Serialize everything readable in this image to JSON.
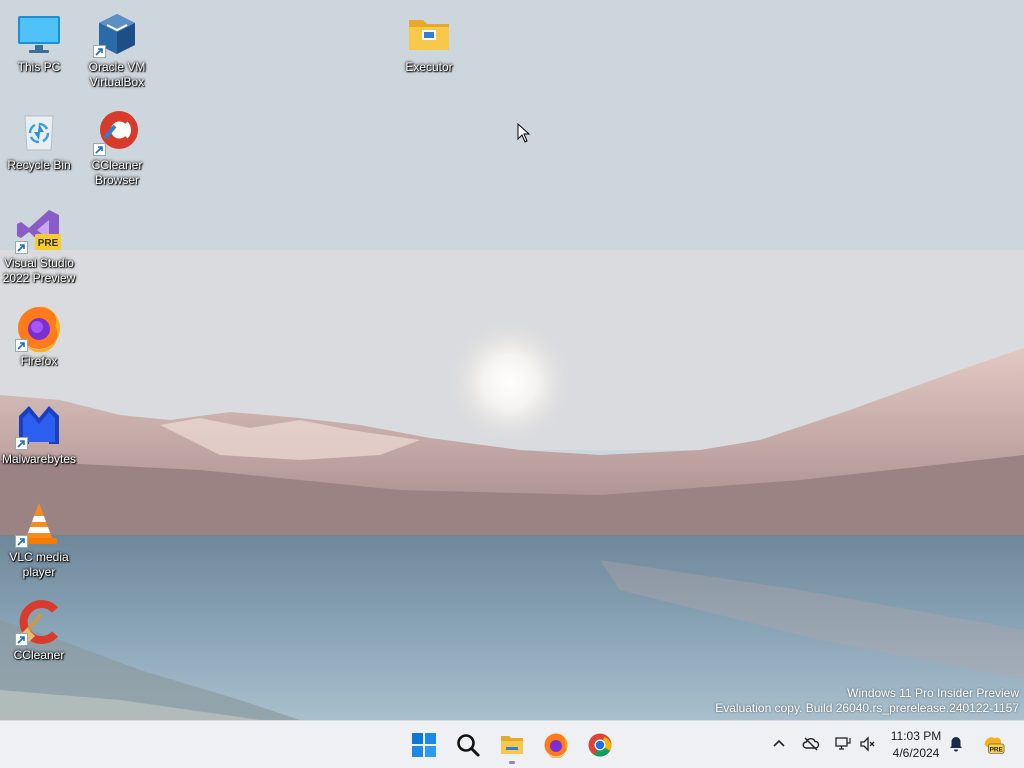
{
  "desktop": {
    "icons": [
      {
        "label": "This PC",
        "icon": "monitor-icon",
        "shortcut": false
      },
      {
        "label": "Oracle VM VirtualBox",
        "icon": "virtualbox-icon",
        "shortcut": true
      },
      {
        "label": "Executor",
        "icon": "folder-icon",
        "shortcut": false
      },
      {
        "label": "Recycle Bin",
        "icon": "recycle-bin-icon",
        "shortcut": false
      },
      {
        "label": "CCleaner Browser",
        "icon": "ccleaner-browser-icon",
        "shortcut": true
      },
      {
        "label": "Visual Studio 2022 Preview",
        "icon": "visual-studio-icon",
        "shortcut": true,
        "badge": "PRE"
      },
      {
        "label": "Firefox",
        "icon": "firefox-icon",
        "shortcut": true
      },
      {
        "label": "Malwarebytes",
        "icon": "malwarebytes-icon",
        "shortcut": true
      },
      {
        "label": "VLC media player",
        "icon": "vlc-icon",
        "shortcut": true
      },
      {
        "label": "CCleaner",
        "icon": "ccleaner-icon",
        "shortcut": true
      }
    ]
  },
  "watermark": {
    "line1": "Windows 11 Pro Insider Preview",
    "line2": "Evaluation copy. Build 26040.rs_prerelease.240122-1157"
  },
  "taskbar": {
    "apps": [
      {
        "name": "start",
        "icon": "windows-start-icon"
      },
      {
        "name": "search",
        "icon": "search-icon"
      },
      {
        "name": "file-explorer",
        "icon": "file-explorer-icon",
        "active": true
      },
      {
        "name": "firefox",
        "icon": "firefox-icon"
      },
      {
        "name": "chrome",
        "icon": "chrome-icon"
      }
    ],
    "tray": {
      "icons": [
        "chevron-up-icon",
        "onedrive-offline-icon",
        "network-icon",
        "volume-muted-icon",
        "notification-bell-icon",
        "copilot-pre-icon"
      ],
      "copilot_badge": "PRE"
    },
    "clock": {
      "time": "11:03 PM",
      "date": "4/6/2024"
    }
  },
  "colors": {
    "taskbar_bg": "#eef0f3",
    "windows_blue": "#0a78d4",
    "chrome_red": "#db4437",
    "chrome_yellow": "#f4b400",
    "chrome_green": "#0f9d58"
  }
}
